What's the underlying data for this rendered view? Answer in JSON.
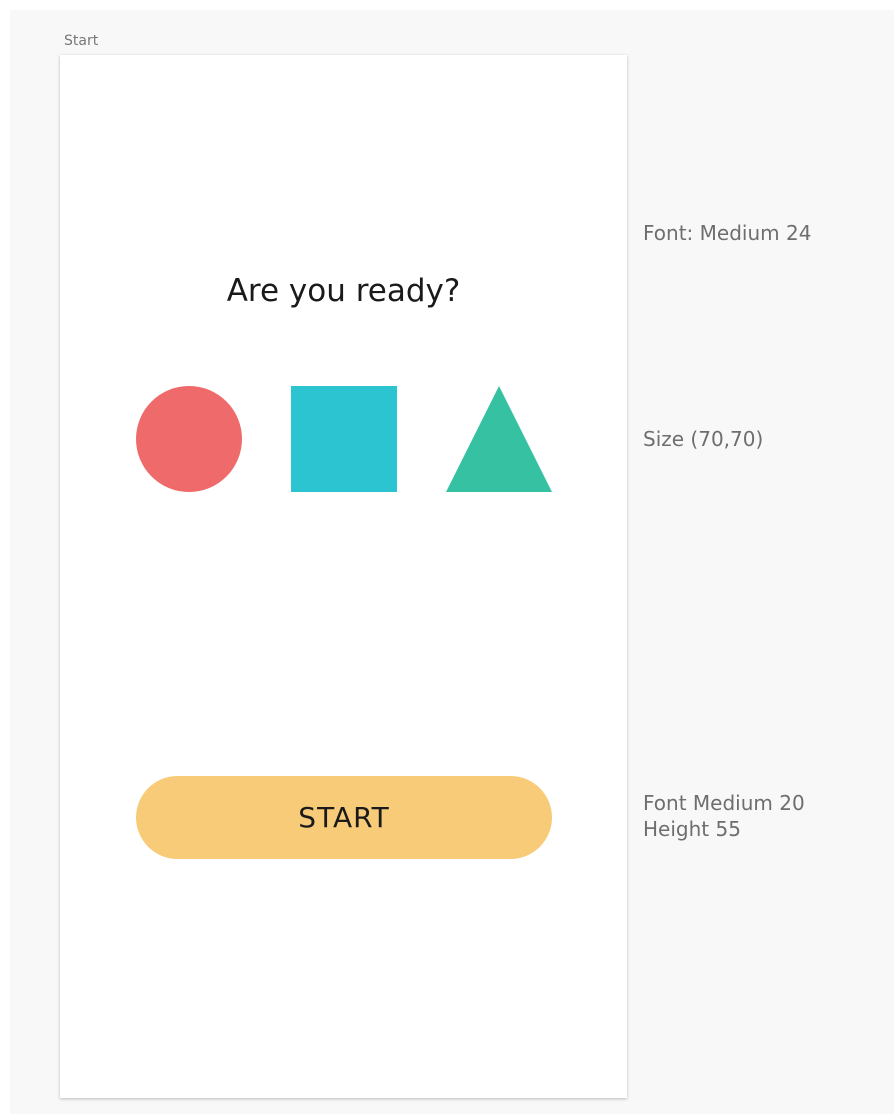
{
  "artboard": {
    "label": "Start"
  },
  "screen": {
    "title": "Are you ready?",
    "shapes": [
      {
        "name": "circle",
        "color": "#ef6b6b"
      },
      {
        "name": "square",
        "color": "#2bc4d0"
      },
      {
        "name": "triangle",
        "color": "#36c1a2"
      }
    ],
    "start_button": {
      "label": "START",
      "color": "#f7cb78"
    }
  },
  "annotations": {
    "title_font": "Font: Medium 24",
    "shape_size": "Size (70,70)",
    "button_font": "Font Medium 20",
    "button_height": "Height 55"
  },
  "colors": {
    "canvas": "#f8f8f8",
    "screen": "#ffffff",
    "text": "#1a1a1a",
    "annotation_text": "#6e6e6e"
  }
}
